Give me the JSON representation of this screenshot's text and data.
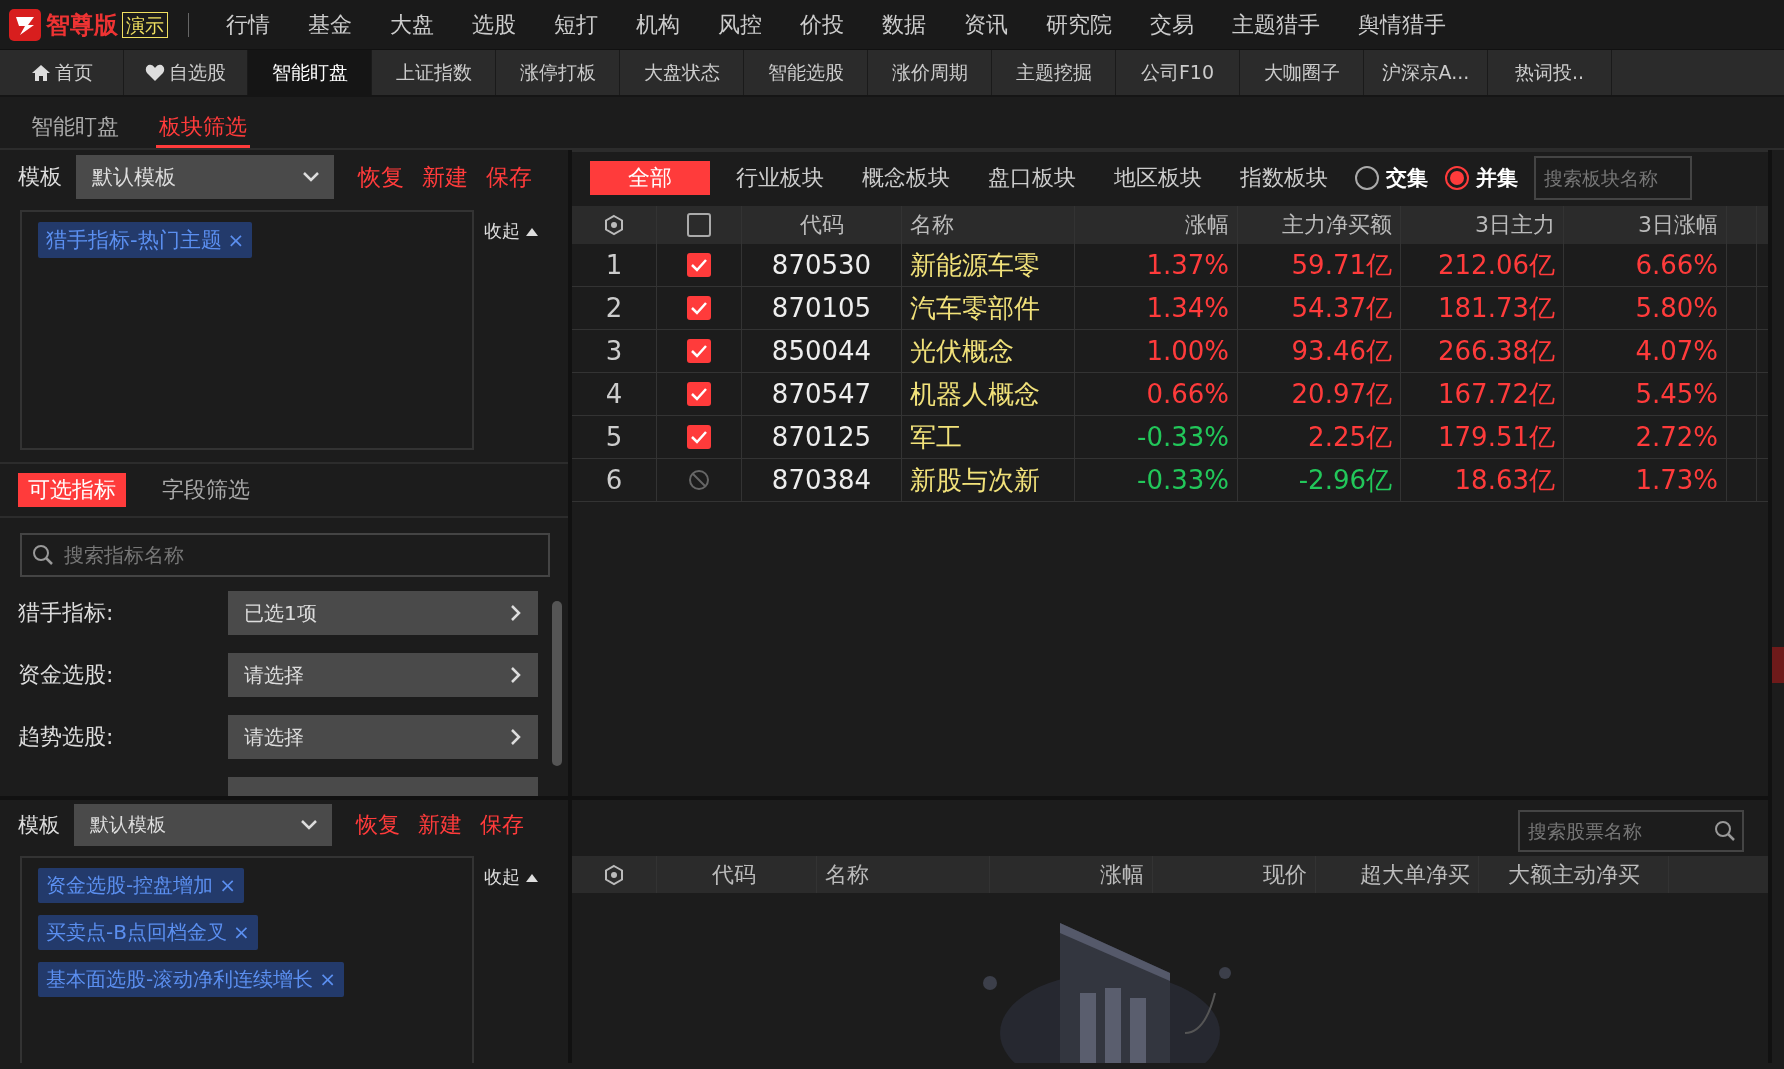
{
  "app": {
    "logo_text": "智尊版",
    "badge": "演示"
  },
  "main_menu": [
    "行情",
    "基金",
    "大盘",
    "选股",
    "短打",
    "机构",
    "风控",
    "价投",
    "数据",
    "资讯",
    "研究院",
    "交易",
    "主题猎手",
    "舆情猎手"
  ],
  "tabs": [
    {
      "label": "首页",
      "kind": "home",
      "selected": false
    },
    {
      "label": "自选股",
      "kind": "heart",
      "selected": false
    },
    {
      "label": "智能盯盘",
      "selected": true
    },
    {
      "label": "上证指数",
      "selected": false
    },
    {
      "label": "涨停打板",
      "selected": false
    },
    {
      "label": "大盘状态",
      "selected": false
    },
    {
      "label": "智能选股",
      "selected": false
    },
    {
      "label": "涨价周期",
      "selected": false
    },
    {
      "label": "主题挖掘",
      "selected": false
    },
    {
      "label": "公司F10",
      "selected": false
    },
    {
      "label": "大咖圈子",
      "selected": false
    },
    {
      "label": "沪深京A...",
      "selected": false
    },
    {
      "label": "热词投..",
      "selected": false
    }
  ],
  "sub_tabs": [
    {
      "label": "智能盯盘",
      "selected": false
    },
    {
      "label": "板块筛选",
      "selected": true
    }
  ],
  "sector_filter_panel": {
    "template_label": "模板",
    "template_value": "默认模板",
    "actions": [
      "恢复",
      "新建",
      "保存"
    ],
    "collapse": "收起",
    "tags": [
      {
        "label": "猎手指标-热门主题",
        "close": "×"
      }
    ]
  },
  "indicator_tabs": [
    {
      "label": "可选指标",
      "selected": true
    },
    {
      "label": "字段筛选",
      "selected": false
    }
  ],
  "indicator_search": {
    "placeholder": "搜索指标名称"
  },
  "indicators": [
    {
      "label": "猎手指标:",
      "value": "已选1项"
    },
    {
      "label": "资金选股:",
      "value": "请选择"
    },
    {
      "label": "趋势选股:",
      "value": "请选择"
    }
  ],
  "stock_filter_panel": {
    "template_label": "模板",
    "template_value": "默认模板",
    "actions": [
      "恢复",
      "新建",
      "保存"
    ],
    "collapse": "收起",
    "tags": [
      {
        "label": "资金选股-控盘增加",
        "close": "×"
      },
      {
        "label": "买卖点-B点回档金叉",
        "close": "×"
      },
      {
        "label": "基本面选股-滚动净利连续增长",
        "close": "×"
      }
    ]
  },
  "sector_types": [
    {
      "label": "全部",
      "selected": true
    },
    {
      "label": "行业板块",
      "selected": false
    },
    {
      "label": "概念板块",
      "selected": false
    },
    {
      "label": "盘口板块",
      "selected": false
    },
    {
      "label": "地区板块",
      "selected": false
    },
    {
      "label": "指数板块",
      "selected": false
    }
  ],
  "set_modes": [
    {
      "label": "交集",
      "selected": false
    },
    {
      "label": "并集",
      "selected": true
    }
  ],
  "sector_search": {
    "placeholder": "搜索板块名称"
  },
  "sector_table": {
    "select_all": {
      "checked": false
    },
    "columns": [
      "代码",
      "名称",
      "涨幅",
      "主力净买额",
      "3日主力",
      "3日涨幅"
    ],
    "rows": [
      {
        "index": "1",
        "checked": true,
        "disabled": false,
        "code": "870530",
        "name": "新能源车零",
        "values": [
          {
            "text": "1.37%",
            "up": true
          },
          {
            "text": "59.71亿",
            "up": true
          },
          {
            "text": "212.06亿",
            "up": true
          },
          {
            "text": "6.66%",
            "up": true
          }
        ]
      },
      {
        "index": "2",
        "checked": true,
        "disabled": false,
        "code": "870105",
        "name": "汽车零部件",
        "values": [
          {
            "text": "1.34%",
            "up": true
          },
          {
            "text": "54.37亿",
            "up": true
          },
          {
            "text": "181.73亿",
            "up": true
          },
          {
            "text": "5.80%",
            "up": true
          }
        ]
      },
      {
        "index": "3",
        "checked": true,
        "disabled": false,
        "code": "850044",
        "name": "光伏概念",
        "values": [
          {
            "text": "1.00%",
            "up": true
          },
          {
            "text": "93.46亿",
            "up": true
          },
          {
            "text": "266.38亿",
            "up": true
          },
          {
            "text": "4.07%",
            "up": true
          }
        ]
      },
      {
        "index": "4",
        "checked": true,
        "disabled": false,
        "code": "870547",
        "name": "机器人概念",
        "values": [
          {
            "text": "0.66%",
            "up": true
          },
          {
            "text": "20.97亿",
            "up": true
          },
          {
            "text": "167.72亿",
            "up": true
          },
          {
            "text": "5.45%",
            "up": true
          }
        ]
      },
      {
        "index": "5",
        "checked": true,
        "disabled": false,
        "code": "870125",
        "name": "军工",
        "values": [
          {
            "text": "-0.33%",
            "up": false
          },
          {
            "text": "2.25亿",
            "up": true
          },
          {
            "text": "179.51亿",
            "up": true
          },
          {
            "text": "2.72%",
            "up": true
          }
        ]
      },
      {
        "index": "6",
        "checked": false,
        "disabled": true,
        "code": "870384",
        "name": "新股与次新",
        "values": [
          {
            "text": "-0.33%",
            "up": false
          },
          {
            "text": "-2.96亿",
            "up": false
          },
          {
            "text": "18.63亿",
            "up": true
          },
          {
            "text": "1.73%",
            "up": true
          }
        ]
      }
    ]
  },
  "stock_search": {
    "placeholder": "搜索股票名称"
  },
  "stock_table": {
    "columns": [
      "代码",
      "名称",
      "涨幅",
      "现价",
      "超大单净买",
      "大额主动净买"
    ]
  }
}
